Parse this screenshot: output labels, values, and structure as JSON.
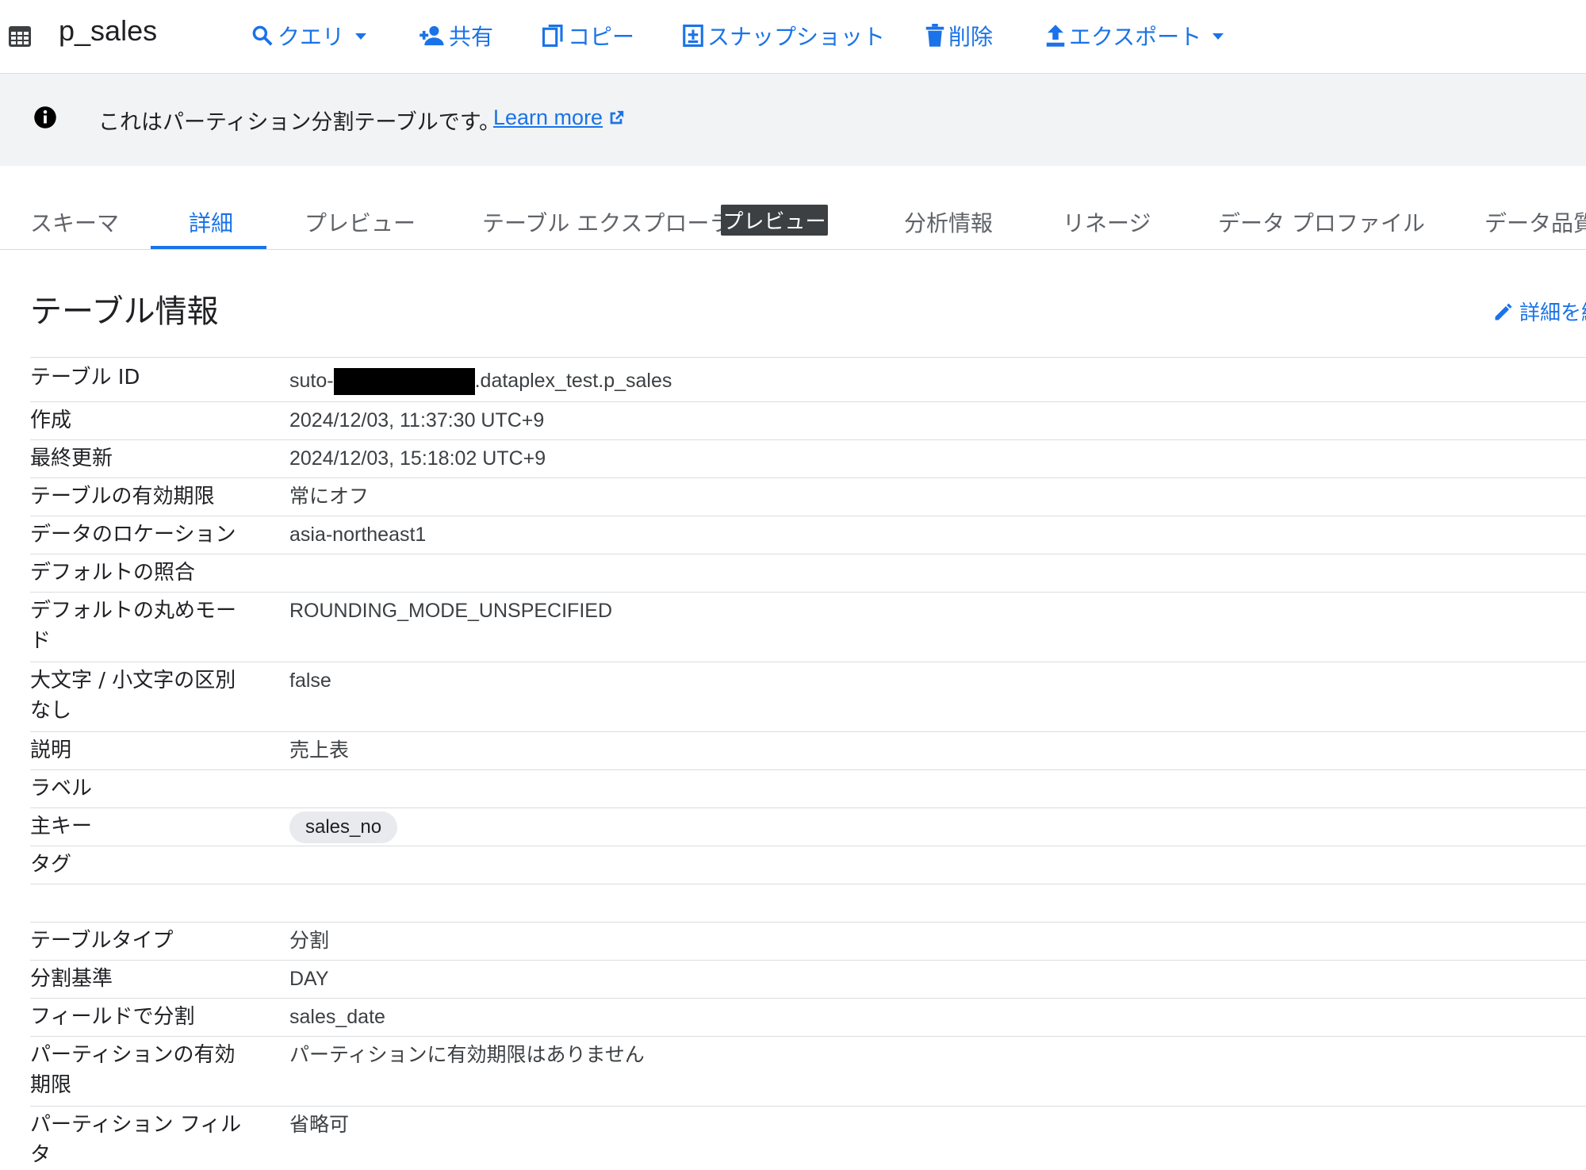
{
  "toolbar": {
    "title": "p_sales",
    "query_label": "クエリ",
    "share_label": "共有",
    "copy_label": "コピー",
    "snapshot_label": "スナップショット",
    "delete_label": "削除",
    "export_label": "エクスポート"
  },
  "banner": {
    "text": "これはパーティション分割テーブルです。",
    "link_label": "Learn more"
  },
  "tabs": {
    "schema": "スキーマ",
    "details": "詳細",
    "preview": "プレビュー",
    "explorer": "テーブル エクスプローラ",
    "explorer_badge": "プレビュー",
    "insights": "分析情報",
    "lineage": "リネージ",
    "profile": "データ プロファイル",
    "quality": "データ品質"
  },
  "section": {
    "title": "テーブル情報",
    "edit_label": "詳細を編"
  },
  "details": {
    "table_id_label": "テーブル ID",
    "table_id_prefix": "suto-",
    "table_id_suffix": ".dataplex_test.p_sales",
    "created_label": "作成",
    "created_value": "2024/12/03, 11:37:30 UTC+9",
    "modified_label": "最終更新",
    "modified_value": "2024/12/03, 15:18:02 UTC+9",
    "expiration_label": "テーブルの有効期限",
    "expiration_value": "常にオフ",
    "location_label": "データのロケーション",
    "location_value": "asia-northeast1",
    "collation_label": "デフォルトの照合",
    "rounding_label": "デフォルトの丸めモード",
    "rounding_value": "ROUNDING_MODE_UNSPECIFIED",
    "case_label": "大文字 / 小文字の区別なし",
    "case_value": "false",
    "description_label": "説明",
    "description_value": "売上表",
    "labels_label": "ラベル",
    "primary_key_label": "主キー",
    "primary_key_value": "sales_no",
    "tags_label": "タグ",
    "table_type_label": "テーブルタイプ",
    "table_type_value": "分割",
    "partition_basis_label": "分割基準",
    "partition_basis_value": "DAY",
    "partition_field_label": "フィールドで分割",
    "partition_field_value": "sales_date",
    "partition_expiration_label": "パーティションの有効期限",
    "partition_expiration_value": "パーティションに有効期限はありません",
    "partition_filter_label": "パーティション フィルタ",
    "partition_filter_value": "省略可"
  },
  "colors": {
    "accent": "#1a73e8",
    "banner_bg": "#f1f3f4",
    "divider": "#dadce0",
    "badge_bg": "#3c4043"
  },
  "icons": [
    "table-icon",
    "search-icon",
    "person-add-icon",
    "copy-icon",
    "snapshot-icon",
    "trash-icon",
    "upload-icon",
    "info-icon",
    "external-link-icon",
    "pencil-icon"
  ]
}
